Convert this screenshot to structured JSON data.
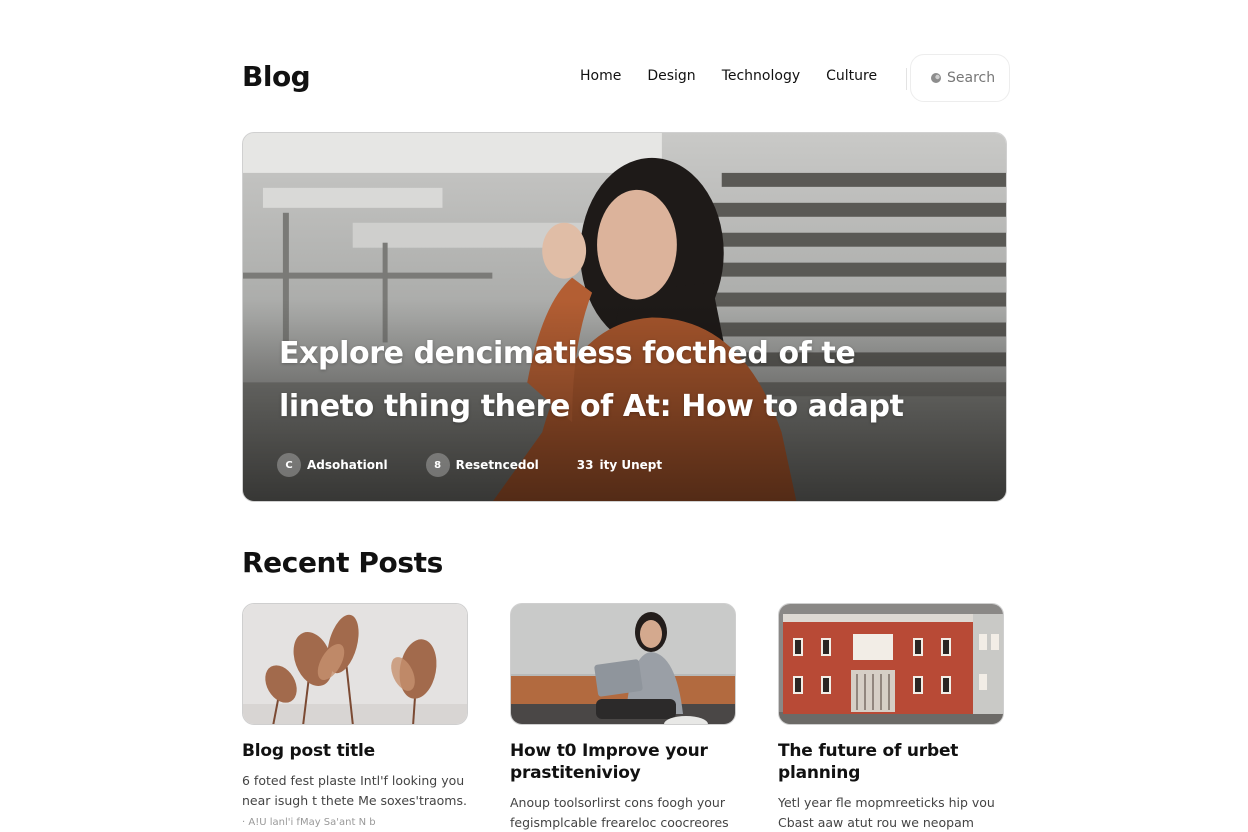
{
  "header": {
    "logo": "Blog",
    "nav": [
      "Home",
      "Design",
      "Technology",
      "Culture"
    ],
    "search_label": "Search"
  },
  "hero": {
    "title_line1": "Explore dencimatiess focthed of te",
    "title_line2": "lineto thing there of At: How to adapt",
    "meta": [
      {
        "icon": "C",
        "label": "Adsohationl"
      },
      {
        "icon": "8",
        "label": "Resetncedol"
      },
      {
        "icon": "33",
        "label": "ity Unept"
      }
    ]
  },
  "recent": {
    "heading": "Recent Posts",
    "posts": [
      {
        "title": "Blog post title",
        "excerpt": "6 foted fest plaste Intl'f looking you near isugh t thete Me soxes'traoms.",
        "date": "· A!U lanl'i fMay Sa'ant N b"
      },
      {
        "title": "How t0 Improve your prastitenivioy",
        "excerpt": "Anoup toolsorlirst cons foogh your fegismplcable freareloc coocreores",
        "date": ""
      },
      {
        "title": "The future of urbet planning",
        "excerpt": "Yetl year fle mopmreeticks hip vou Cbast aaw atut rou we neopam arms",
        "date": ""
      }
    ]
  },
  "colors": {
    "hero_sweater": "#a5552c",
    "building_red": "#b84a36",
    "text": "#111111"
  }
}
